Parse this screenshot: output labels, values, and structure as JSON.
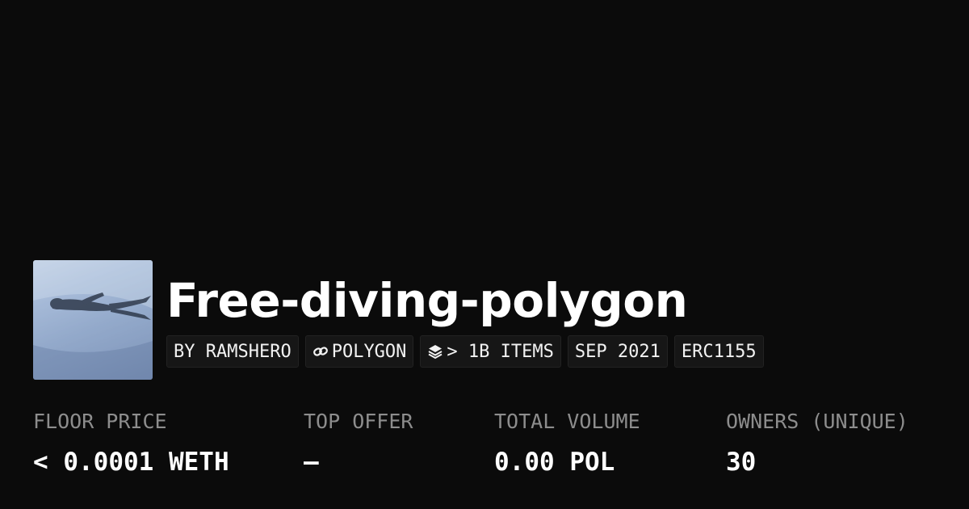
{
  "collection": {
    "title": "Free-diving-polygon",
    "thumbnail_icon": "free-diver-image",
    "chips": {
      "creator": "BY RAMSHERO",
      "chain": "POLYGON",
      "chain_icon": "link-icon",
      "items": "> 1B ITEMS",
      "items_icon": "layers-icon",
      "created": "SEP 2021",
      "standard": "ERC1155"
    }
  },
  "stats": {
    "floor_price": {
      "label": "FLOOR PRICE",
      "value": "< 0.0001 WETH"
    },
    "top_offer": {
      "label": "TOP OFFER",
      "value": "—"
    },
    "total_volume": {
      "label": "TOTAL VOLUME",
      "value": "0.00 POL"
    },
    "owners": {
      "label": "OWNERS (UNIQUE)",
      "value": "30"
    }
  },
  "colors": {
    "background": "#0b0b0b",
    "chip_background": "#161616",
    "label_gray": "#8d8d8d",
    "text": "#ffffff"
  }
}
